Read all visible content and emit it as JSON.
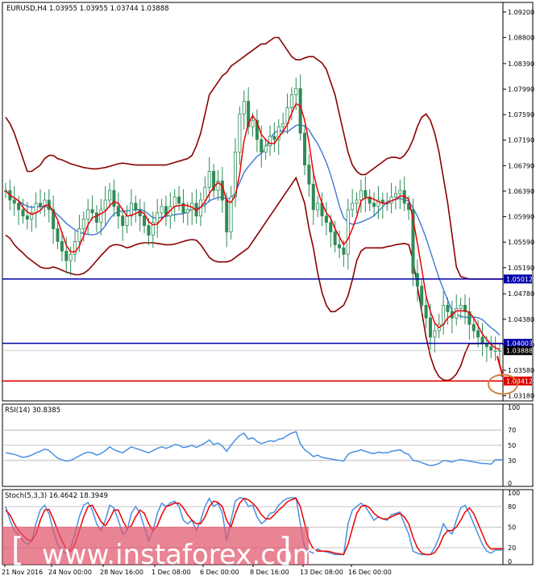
{
  "main": {
    "header": "EURUSD,H4  1.03955 1.03955 1.03744 1.03888",
    "y_ticks": [
      "1.09200",
      "1.08800",
      "1.08390",
      "1.07990",
      "1.07590",
      "1.07190",
      "1.06790",
      "1.06390",
      "1.05990",
      "1.05590",
      "1.05190",
      "1.04780",
      "1.04380",
      "1.03980",
      "1.03580",
      "1.03180"
    ],
    "level_tags": [
      {
        "text": "1.05012",
        "value": 1.05012,
        "color": "#0000aa",
        "text_color": "#ffffff"
      },
      {
        "text": "1.04003",
        "value": 1.04003,
        "color": "#0000aa",
        "text_color": "#ffffff"
      },
      {
        "text": "1.03888",
        "value": 1.03888,
        "color": "#000000",
        "text_color": "#ffffff"
      },
      {
        "text": "1.03412",
        "value": 1.03412,
        "color": "#dd0000",
        "text_color": "#ffffff"
      }
    ]
  },
  "rsi": {
    "header": "RSI(14) 30.8385",
    "y_ticks": [
      "100",
      "70",
      "50",
      "30",
      "0"
    ]
  },
  "stoch": {
    "header": "Stoch(5,3,3) 16.4642 18.3949",
    "y_ticks": [
      "100",
      "80",
      "50",
      "20",
      "0"
    ]
  },
  "x_labels": [
    "21 Nov 2016",
    "24 Nov 00:00",
    "28 Nov 16:00",
    "1 Dec 08:00",
    "6 Dec 00:00",
    "8 Dec 16:00",
    "13 Dec 08:00",
    "16 Dec 00:00"
  ],
  "watermark": "www.instaforex.com",
  "colors": {
    "bull": "#2e8b57",
    "bear": "#2e8b57",
    "bands": "#8b0000",
    "ma_fast": "#ee0000",
    "ma_slow": "#4a7fd8",
    "support": "#0000aa",
    "resistance": "#dd0000",
    "rsi": "#4a90e2",
    "stoch_main": "#4a90e2",
    "stoch_signal": "#ee0000",
    "highlight_circle": "#cd853f"
  },
  "chart_data": [
    {
      "type": "candlestick",
      "title": "EURUSD,H4  1.03955 1.03955 1.03744 1.03888",
      "timeframe": "H4",
      "ylim": [
        1.031,
        1.0935
      ],
      "x_range": [
        0,
        115
      ],
      "series": {
        "close": [
          1.064,
          1.0625,
          1.062,
          1.061,
          1.06,
          1.0595,
          1.0605,
          1.062,
          1.0615,
          1.0625,
          1.061,
          1.058,
          1.056,
          1.0545,
          1.053,
          1.054,
          1.056,
          1.058,
          1.0595,
          1.061,
          1.0605,
          1.059,
          1.061,
          1.0625,
          1.064,
          1.0615,
          1.06,
          1.0585,
          1.06,
          1.062,
          1.061,
          1.06,
          1.0585,
          1.057,
          1.059,
          1.0605,
          1.0615,
          1.06,
          1.0615,
          1.063,
          1.062,
          1.0605,
          1.061,
          1.062,
          1.06,
          1.0625,
          1.0645,
          1.067,
          1.064,
          1.0655,
          1.0625,
          1.0575,
          1.063,
          1.07,
          1.076,
          1.078,
          1.074,
          1.075,
          1.072,
          1.07,
          1.071,
          1.0725,
          1.072,
          1.074,
          1.0745,
          1.077,
          1.079,
          1.08,
          1.073,
          1.068,
          1.065,
          1.061,
          1.062,
          1.06,
          1.059,
          1.0575,
          1.0555,
          1.055,
          1.054,
          1.061,
          1.062,
          1.0625,
          1.064,
          1.063,
          1.062,
          1.0615,
          1.0625,
          1.062,
          1.062,
          1.063,
          1.0635,
          1.064,
          1.062,
          1.061,
          1.051,
          1.049,
          1.046,
          1.044,
          1.041,
          1.042,
          1.043,
          1.046,
          1.045,
          1.044,
          1.0455,
          1.046,
          1.045,
          1.043,
          1.042,
          1.041,
          1.04,
          1.0395,
          1.0389,
          1.0389,
          1.0389
        ],
        "band_upper": [
          1.0755,
          1.0745,
          1.073,
          1.071,
          1.069,
          1.067,
          1.067,
          1.0675,
          1.068,
          1.069,
          1.0695,
          1.0695,
          1.069,
          1.0688,
          1.0685,
          1.0682,
          1.068,
          1.0678,
          1.0676,
          1.0675,
          1.0674,
          1.0674,
          1.0675,
          1.0676,
          1.0678,
          1.068,
          1.0682,
          1.0683,
          1.0682,
          1.0681,
          1.068,
          1.068,
          1.068,
          1.068,
          1.068,
          1.068,
          1.068,
          1.068,
          1.0682,
          1.0684,
          1.0686,
          1.0688,
          1.069,
          1.0695,
          1.071,
          1.073,
          1.076,
          1.079,
          1.08,
          1.081,
          1.082,
          1.0825,
          1.0835,
          1.084,
          1.0845,
          1.085,
          1.0855,
          1.086,
          1.0865,
          1.087,
          1.087,
          1.0875,
          1.088,
          1.088,
          1.087,
          1.086,
          1.085,
          1.0845,
          1.0845,
          1.0848,
          1.085,
          1.085,
          1.0845,
          1.084,
          1.083,
          1.081,
          1.079,
          1.076,
          1.073,
          1.07,
          1.068,
          1.067,
          1.0665,
          1.0665,
          1.067,
          1.0675,
          1.068,
          1.0685,
          1.069,
          1.0692,
          1.0692,
          1.069,
          1.0695,
          1.0705,
          1.072,
          1.074,
          1.0755,
          1.076,
          1.075,
          1.073,
          1.07,
          1.066,
          1.062,
          1.057,
          1.052,
          1.0505,
          1.0503,
          1.0501,
          1.0501,
          1.0501,
          1.0501,
          1.0501,
          1.0501,
          1.0501,
          1.0501,
          1.0501
        ],
        "band_lower": [
          1.057,
          1.0565,
          1.0555,
          1.0548,
          1.0542,
          1.0535,
          1.053,
          1.0525,
          1.052,
          1.0518,
          1.0518,
          1.052,
          1.0518,
          1.0515,
          1.0512,
          1.051,
          1.0508,
          1.0508,
          1.051,
          1.0515,
          1.0522,
          1.053,
          1.0538,
          1.0545,
          1.0552,
          1.0555,
          1.0555,
          1.0553,
          1.055,
          1.0552,
          1.0555,
          1.0557,
          1.0558,
          1.0558,
          1.0558,
          1.0557,
          1.0556,
          1.0555,
          1.0555,
          1.0556,
          1.0558,
          1.056,
          1.0562,
          1.0563,
          1.0562,
          1.0555,
          1.0545,
          1.0535,
          1.053,
          1.0528,
          1.0528,
          1.0528,
          1.053,
          1.0535,
          1.054,
          1.0545,
          1.055,
          1.056,
          1.057,
          1.058,
          1.059,
          1.06,
          1.061,
          1.062,
          1.063,
          1.064,
          1.065,
          1.066,
          1.064,
          1.062,
          1.058,
          1.055,
          1.051,
          1.048,
          1.046,
          1.045,
          1.045,
          1.0455,
          1.046,
          1.0475,
          1.05,
          1.053,
          1.0545,
          1.055,
          1.055,
          1.055,
          1.055,
          1.055,
          1.0552,
          1.0553,
          1.0555,
          1.0556,
          1.0557,
          1.0555,
          1.053,
          1.049,
          1.045,
          1.041,
          1.038,
          1.036,
          1.0348,
          1.0343,
          1.0342,
          1.0345,
          1.0352,
          1.0365,
          1.0385,
          1.04,
          1.04,
          1.04,
          1.04,
          1.04,
          1.04,
          1.04,
          1.04,
          1.04
        ]
      },
      "levels": [
        1.05012,
        1.04003,
        1.03412
      ],
      "last_price": 1.03888
    },
    {
      "type": "line",
      "name": "RSI(14)",
      "value": 30.8385,
      "ylim": [
        0,
        100
      ],
      "levels": [
        70,
        50,
        30
      ],
      "values": [
        40,
        39,
        38,
        36,
        34,
        35,
        37,
        40,
        42,
        45,
        43,
        38,
        33,
        31,
        29,
        30,
        33,
        36,
        39,
        41,
        40,
        37,
        39,
        43,
        48,
        44,
        42,
        40,
        44,
        48,
        46,
        44,
        42,
        40,
        43,
        46,
        48,
        46,
        48,
        51,
        50,
        47,
        48,
        50,
        47,
        50,
        53,
        57,
        51,
        53,
        49,
        42,
        50,
        57,
        63,
        66,
        58,
        60,
        55,
        52,
        54,
        56,
        55,
        58,
        59,
        63,
        66,
        68,
        52,
        44,
        40,
        35,
        37,
        34,
        33,
        32,
        31,
        30,
        29,
        38,
        41,
        42,
        44,
        42,
        40,
        39,
        41,
        40,
        40,
        42,
        43,
        44,
        40,
        38,
        30,
        29,
        27,
        25,
        23,
        24,
        26,
        30,
        29,
        28,
        30,
        31,
        30,
        29,
        28,
        27,
        26,
        26,
        25,
        30.8,
        30.8,
        30.8
      ]
    },
    {
      "type": "line",
      "name": "Stoch(5,3,3)",
      "main": 16.4642,
      "signal": 18.3949,
      "ylim": [
        0,
        100
      ],
      "levels": [
        80,
        50,
        20
      ],
      "values_main": [
        80,
        60,
        45,
        38,
        30,
        25,
        30,
        55,
        75,
        82,
        70,
        45,
        25,
        15,
        12,
        20,
        40,
        65,
        82,
        86,
        75,
        55,
        45,
        60,
        82,
        78,
        60,
        40,
        45,
        70,
        80,
        70,
        50,
        30,
        45,
        70,
        85,
        80,
        85,
        88,
        80,
        60,
        55,
        60,
        45,
        60,
        80,
        92,
        80,
        85,
        70,
        30,
        60,
        88,
        93,
        92,
        80,
        82,
        65,
        55,
        60,
        70,
        72,
        82,
        88,
        92,
        93,
        93,
        55,
        20,
        15,
        12,
        18,
        15,
        14,
        12,
        10,
        10,
        10,
        55,
        75,
        80,
        85,
        80,
        70,
        60,
        65,
        62,
        60,
        68,
        70,
        72,
        55,
        40,
        15,
        12,
        10,
        10,
        10,
        20,
        35,
        55,
        45,
        40,
        60,
        78,
        82,
        70,
        55,
        40,
        25,
        15,
        12,
        16.5,
        16.5,
        16.5
      ],
      "values_signal": [
        75,
        68,
        55,
        45,
        38,
        32,
        30,
        40,
        60,
        75,
        76,
        62,
        45,
        30,
        18,
        15,
        25,
        45,
        65,
        80,
        82,
        70,
        58,
        52,
        62,
        75,
        75,
        60,
        48,
        52,
        65,
        75,
        70,
        55,
        45,
        52,
        68,
        80,
        82,
        85,
        85,
        78,
        68,
        60,
        55,
        55,
        65,
        80,
        88,
        86,
        80,
        60,
        50,
        70,
        85,
        92,
        90,
        85,
        78,
        68,
        62,
        62,
        68,
        75,
        80,
        87,
        90,
        92,
        80,
        55,
        30,
        18,
        15,
        15,
        15,
        14,
        12,
        11,
        10,
        25,
        48,
        70,
        80,
        82,
        78,
        70,
        65,
        62,
        62,
        65,
        68,
        70,
        65,
        55,
        35,
        20,
        12,
        10,
        10,
        13,
        22,
        37,
        45,
        45,
        50,
        60,
        72,
        78,
        70,
        55,
        40,
        25,
        18,
        18.4,
        18.4,
        18.4
      ]
    }
  ]
}
